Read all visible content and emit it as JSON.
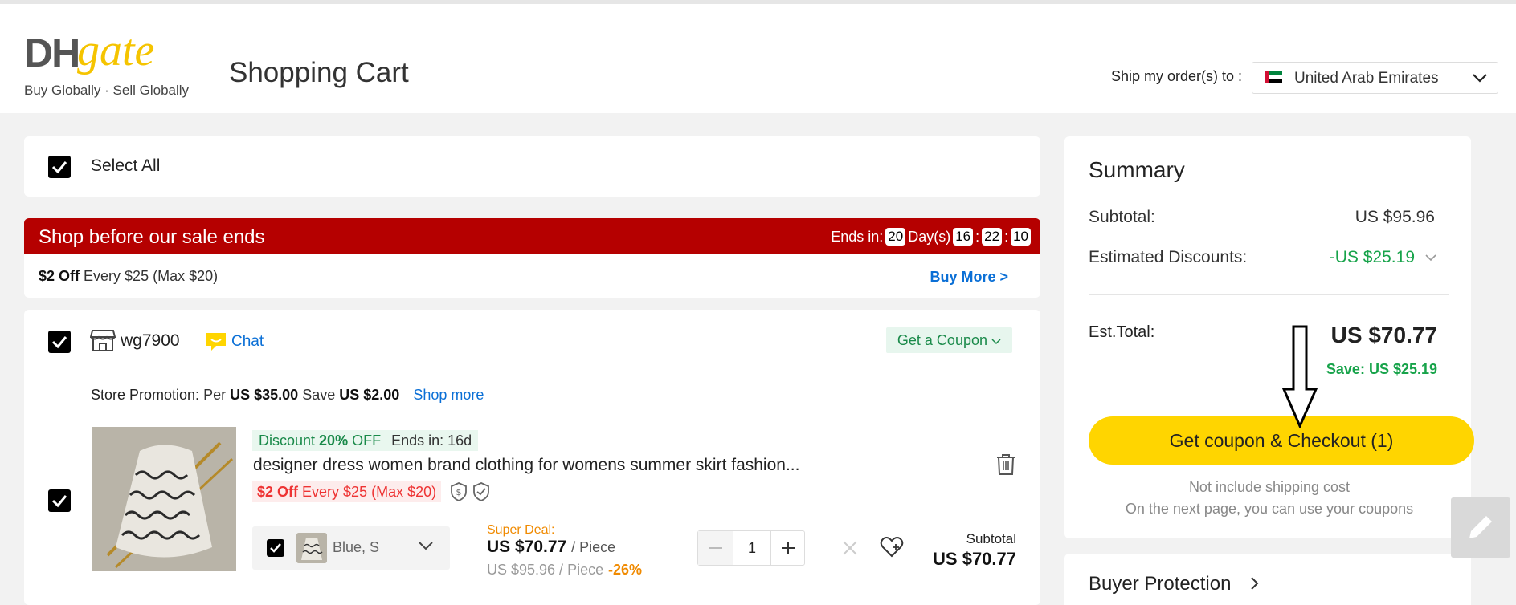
{
  "header": {
    "logo_dh": "DH",
    "logo_gate": "gate",
    "logo_tagline": "Buy Globally · Sell Globally",
    "page_title": "Shopping Cart",
    "ship_label": "Ship my order(s) to :",
    "ship_country": "United Arab Emirates"
  },
  "select_all": {
    "label": "Select All",
    "checked": true
  },
  "sale_banner": {
    "title": "Shop before our sale ends",
    "ends_label": "Ends in:",
    "days": "20",
    "days_label": "Day(s)",
    "hours": "16",
    "minutes": "22",
    "seconds": "10",
    "colon": ":",
    "promo_bold": "$2 Off",
    "promo_text": "Every $25 (Max $20)",
    "buy_more": "Buy More >"
  },
  "store": {
    "name": "wg7900",
    "chat_label": "Chat",
    "coupon_label": "Get a Coupon",
    "promo_label": "Store Promotion:",
    "promo_per": "Per",
    "promo_amount": "US $35.00",
    "promo_save": "Save",
    "promo_save_amount": "US $2.00",
    "shop_more": "Shop more"
  },
  "item": {
    "discount_word": "Discount",
    "discount_pct": "20%",
    "discount_off": "OFF",
    "discount_ends": "Ends in: 16d",
    "title": "designer dress women brand clothing for womens summer skirt fashion...",
    "off_bold": "$2 Off",
    "off_text": "Every $25 (Max $20)",
    "variant": "Blue, S",
    "super_deal": "Super Deal:",
    "price": "US $70.77",
    "price_unit": "/ Piece",
    "old_price": "US $95.96 / Piece",
    "discount_percent": "-26%",
    "quantity": "1",
    "subtotal_label": "Subtotal",
    "subtotal_value": "US $70.77"
  },
  "summary": {
    "title": "Summary",
    "subtotal_label": "Subtotal:",
    "subtotal_value": "US $95.96",
    "discounts_label": "Estimated Discounts:",
    "discounts_value": "-US $25.19",
    "est_total_label": "Est.Total:",
    "est_total_value": "US $70.77",
    "save_text": "Save: US $25.19",
    "checkout_label": "Get coupon & Checkout (1)",
    "note_shipping": "Not include shipping cost",
    "note_coupons": "On the next page, you can use your coupons"
  },
  "buyer_protection": {
    "label": "Buyer Protection"
  },
  "colors": {
    "brand_yellow": "#ffd500",
    "sale_red": "#b50000",
    "link_blue": "#0a6fd6",
    "discount_green": "#17a34a"
  }
}
